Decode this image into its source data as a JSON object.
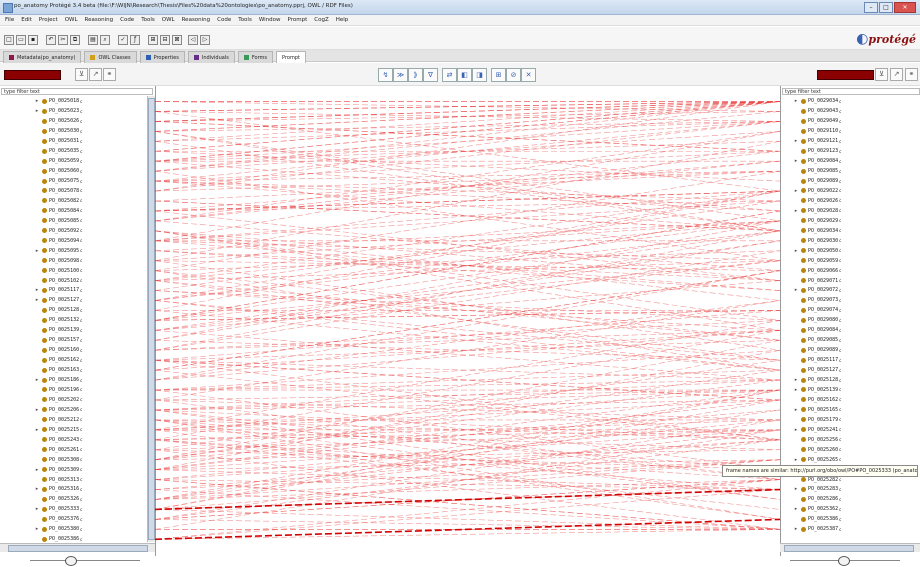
{
  "window": {
    "title": "po_anatomy  Protégé 3.4 beta   (file:\\F:\\WIJN\\Research\\Thesis\\Files%20data%20ontologies\\po_anatomy.pprj, OWL / RDF Files)",
    "buttons": [
      "–",
      "□",
      "✕"
    ]
  },
  "menu": [
    "File",
    "Edit",
    "Project",
    "OWL",
    "Reasoning",
    "Code",
    "Tools",
    "OWL",
    "Reasoning",
    "Code",
    "Tools",
    "Window",
    "Prompt",
    "CogZ",
    "Help"
  ],
  "logo": {
    "text": "protégé",
    "swirl": "◐"
  },
  "tabs": [
    {
      "label": "Metadata(po_anatomy)",
      "color": "#8b1a4a"
    },
    {
      "label": "OWL Classes",
      "color": "#d4a017"
    },
    {
      "label": "Properties",
      "color": "#2f5fb3"
    },
    {
      "label": "Individuals",
      "color": "#6a2c8a"
    },
    {
      "label": "Forms",
      "color": "#3b9a5a"
    },
    {
      "label": "Prompt",
      "color": ""
    }
  ],
  "center_toolbar": [
    "↯",
    "≫",
    "⟫",
    "∇",
    "⇄",
    "◧",
    "◨",
    "⊞",
    "⊘",
    "✕"
  ],
  "left_panel": {
    "filter_placeholder": "type filter text",
    "items": [
      {
        "label": "PO_0025018",
        "exp": "▸"
      },
      {
        "label": "PO_0025023",
        "exp": "▸"
      },
      {
        "label": "PO_0025026",
        "exp": ""
      },
      {
        "label": "PO_0025030",
        "exp": ""
      },
      {
        "label": "PO_0025031",
        "exp": ""
      },
      {
        "label": "PO_0025035",
        "exp": ""
      },
      {
        "label": "PO_0025059",
        "exp": ""
      },
      {
        "label": "PO_0025060",
        "exp": ""
      },
      {
        "label": "PO_0025075",
        "exp": ""
      },
      {
        "label": "PO_0025078",
        "exp": ""
      },
      {
        "label": "PO_0025082",
        "exp": ""
      },
      {
        "label": "PO_0025084",
        "exp": ""
      },
      {
        "label": "PO_0025085",
        "exp": ""
      },
      {
        "label": "PO_0025092",
        "exp": ""
      },
      {
        "label": "PO_0025094",
        "exp": ""
      },
      {
        "label": "PO_0025095",
        "exp": "▸"
      },
      {
        "label": "PO_0025098",
        "exp": ""
      },
      {
        "label": "PO_0025100",
        "exp": ""
      },
      {
        "label": "PO_0025102",
        "exp": ""
      },
      {
        "label": "PO_0025117",
        "exp": "▸"
      },
      {
        "label": "PO_0025127",
        "exp": "▸"
      },
      {
        "label": "PO_0025128",
        "exp": ""
      },
      {
        "label": "PO_0025132",
        "exp": ""
      },
      {
        "label": "PO_0025139",
        "exp": ""
      },
      {
        "label": "PO_0025157",
        "exp": ""
      },
      {
        "label": "PO_0025160",
        "exp": ""
      },
      {
        "label": "PO_0025162",
        "exp": ""
      },
      {
        "label": "PO_0025163",
        "exp": ""
      },
      {
        "label": "PO_0025186",
        "exp": "▸"
      },
      {
        "label": "PO_0025196",
        "exp": ""
      },
      {
        "label": "PO_0025202",
        "exp": ""
      },
      {
        "label": "PO_0025206",
        "exp": "▸"
      },
      {
        "label": "PO_0025212",
        "exp": ""
      },
      {
        "label": "PO_0025215",
        "exp": "▸"
      },
      {
        "label": "PO_0025243",
        "exp": ""
      },
      {
        "label": "PO_0025261",
        "exp": ""
      },
      {
        "label": "PO_0025308",
        "exp": ""
      },
      {
        "label": "PO_0025309",
        "exp": "▸"
      },
      {
        "label": "PO_0025313",
        "exp": ""
      },
      {
        "label": "PO_0025316",
        "exp": "▸"
      },
      {
        "label": "PO_0025326",
        "exp": ""
      },
      {
        "label": "PO_0025333",
        "exp": "▸"
      },
      {
        "label": "PO_0025376",
        "exp": ""
      },
      {
        "label": "PO_0025380",
        "exp": "▸"
      },
      {
        "label": "PO_0025386",
        "exp": ""
      }
    ]
  },
  "right_panel": {
    "filter_placeholder": "type filter text",
    "items": [
      {
        "label": "PO_0029034",
        "exp": "▸"
      },
      {
        "label": "PO_0029043",
        "exp": ""
      },
      {
        "label": "PO_0029049",
        "exp": ""
      },
      {
        "label": "PO_0029110",
        "exp": ""
      },
      {
        "label": "PO_0029121",
        "exp": "▸"
      },
      {
        "label": "PO_0029123",
        "exp": ""
      },
      {
        "label": "PO_0029084",
        "exp": "▸"
      },
      {
        "label": "PO_0029085",
        "exp": ""
      },
      {
        "label": "PO_0029089",
        "exp": ""
      },
      {
        "label": "PO_0029022",
        "exp": "▸"
      },
      {
        "label": "PO_0029026",
        "exp": ""
      },
      {
        "label": "PO_0029028",
        "exp": "▸"
      },
      {
        "label": "PO_0029029",
        "exp": ""
      },
      {
        "label": "PO_0029034",
        "exp": ""
      },
      {
        "label": "PO_0029030",
        "exp": ""
      },
      {
        "label": "PO_0029050",
        "exp": "▸"
      },
      {
        "label": "PO_0029059",
        "exp": ""
      },
      {
        "label": "PO_0029066",
        "exp": ""
      },
      {
        "label": "PO_0029071",
        "exp": ""
      },
      {
        "label": "PO_0029072",
        "exp": "▸"
      },
      {
        "label": "PO_0029073",
        "exp": ""
      },
      {
        "label": "PO_0029074",
        "exp": ""
      },
      {
        "label": "PO_0029080",
        "exp": ""
      },
      {
        "label": "PO_0029084",
        "exp": ""
      },
      {
        "label": "PO_0029085",
        "exp": ""
      },
      {
        "label": "PO_0029089",
        "exp": ""
      },
      {
        "label": "PO_0025117",
        "exp": ""
      },
      {
        "label": "PO_0025127",
        "exp": ""
      },
      {
        "label": "PO_0025128",
        "exp": "▸"
      },
      {
        "label": "PO_0025139",
        "exp": "▸"
      },
      {
        "label": "PO_0025162",
        "exp": ""
      },
      {
        "label": "PO_0025165",
        "exp": "▸"
      },
      {
        "label": "PO_0025179",
        "exp": ""
      },
      {
        "label": "PO_0025241",
        "exp": "▸"
      },
      {
        "label": "PO_0025256",
        "exp": ""
      },
      {
        "label": "PO_0025260",
        "exp": ""
      },
      {
        "label": "PO_0025265",
        "exp": "▸"
      },
      {
        "label": "PO_0025281",
        "exp": ""
      },
      {
        "label": "PO_0025282",
        "exp": ""
      },
      {
        "label": "PO_0025283",
        "exp": "▸"
      },
      {
        "label": "PO_0025286",
        "exp": ""
      },
      {
        "label": "PO_0025362",
        "exp": "▸"
      },
      {
        "label": "PO_0025386",
        "exp": ""
      },
      {
        "label": "PO_0025387",
        "exp": "▸"
      }
    ]
  },
  "tooltip": "frame names are similar: http://purl.org/obo/owl/PO#PO_0025333 (po_anatomy)",
  "colors": {
    "mapping_line": "#e83b3b",
    "strong_line": "#d40000",
    "class_dot": "#b8860b",
    "accent_red": "#8b0000"
  }
}
